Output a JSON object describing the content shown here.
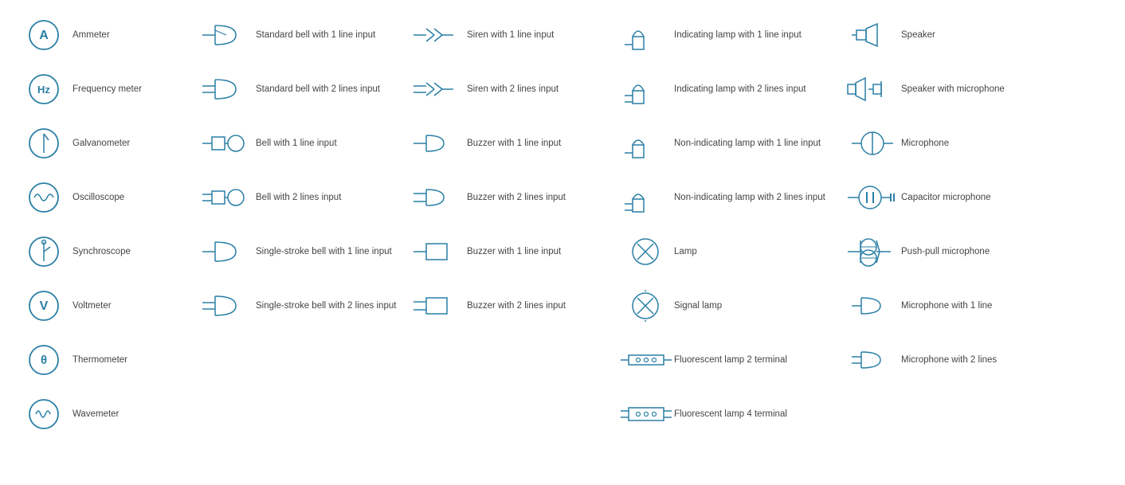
{
  "col1": [
    {
      "label": "Ammeter"
    },
    {
      "label": "Frequency meter"
    },
    {
      "label": "Galvanometer"
    },
    {
      "label": "Oscilloscope"
    },
    {
      "label": "Synchroscope"
    },
    {
      "label": "Voltmeter"
    },
    {
      "label": "Thermometer"
    },
    {
      "label": "Wavemeter"
    }
  ],
  "col2": [
    {
      "label": "Standard bell with 1 line input"
    },
    {
      "label": "Standard bell with 2 lines input"
    },
    {
      "label": "Bell with 1 line input"
    },
    {
      "label": "Bell with 2 lines input"
    },
    {
      "label": "Single-stroke bell with 1 line input"
    },
    {
      "label": "Single-stroke bell with 2 lines input"
    }
  ],
  "col3": [
    {
      "label": "Siren with 1 line input"
    },
    {
      "label": "Siren with 2 lines input"
    },
    {
      "label": "Buzzer with 1 line input"
    },
    {
      "label": "Buzzer with 2 lines input"
    },
    {
      "label": "Buzzer with 1 line input"
    },
    {
      "label": "Buzzer with 2 lines input"
    }
  ],
  "col4": [
    {
      "label": "Indicating lamp with 1 line input"
    },
    {
      "label": "Indicating lamp with 2 lines input"
    },
    {
      "label": "Non-indicating lamp with 1 line input"
    },
    {
      "label": "Non-indicating lamp with 2 lines input"
    },
    {
      "label": "Lamp"
    },
    {
      "label": "Signal lamp"
    },
    {
      "label": "Fluorescent lamp 2 terminal"
    },
    {
      "label": "Fluorescent lamp 4 terminal"
    }
  ],
  "col5": [
    {
      "label": "Speaker"
    },
    {
      "label": "Speaker with microphone"
    },
    {
      "label": "Microphone"
    },
    {
      "label": "Capacitor microphone"
    },
    {
      "label": "Push-pull microphone"
    },
    {
      "label": "Microphone with 1 line"
    },
    {
      "label": "Microphone with 2 lines"
    }
  ]
}
